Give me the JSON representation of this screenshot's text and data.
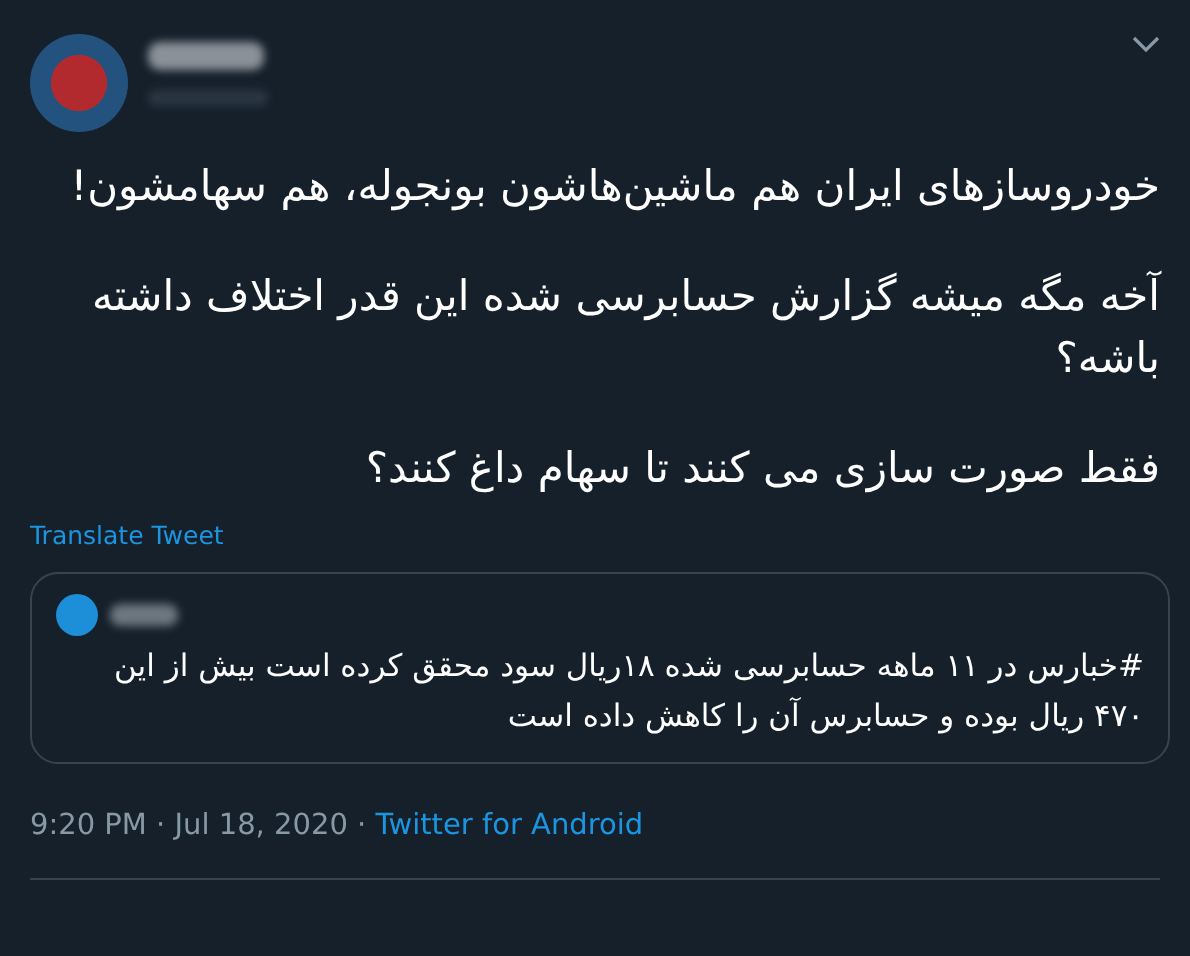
{
  "tweet": {
    "paragraphs": [
      "خودروسازهای ایران هم ماشین‌هاشون بونجوله، هم سهامشون!",
      "آخه مگه میشه گزارش حسابرسی شده این قدر اختلاف داشته باشه؟",
      "فقط صورت سازی می کنند تا سهام داغ کنند؟"
    ],
    "translate_link": "Translate Tweet",
    "quoted_tweet": {
      "text": "#خبارس در ۱۱ ماهه حسابرسی شده ۱۸ریال سود محقق کرده است بیش از این ۴۷۰ ریال بوده و حسابرس آن را کاهش داده است"
    },
    "timestamp": "9:20 PM · Jul 18, 2020 · ",
    "source": "Twitter for Android"
  }
}
